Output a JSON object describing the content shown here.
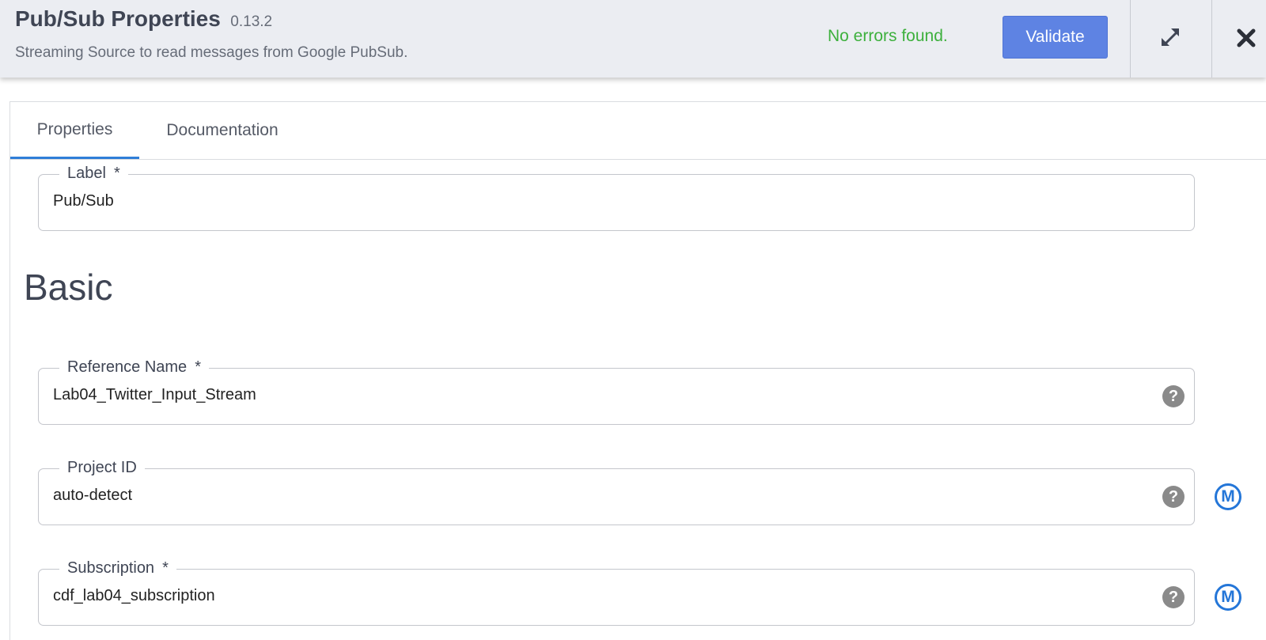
{
  "header": {
    "title": "Pub/Sub Properties",
    "version": "0.13.2",
    "subtitle": "Streaming Source to read messages from Google PubSub.",
    "status_text": "No errors found.",
    "validate_label": "Validate",
    "expand_icon": "expand-arrows-icon",
    "close_icon": "close-icon"
  },
  "tabs": [
    {
      "label": "Properties",
      "active": true
    },
    {
      "label": "Documentation",
      "active": false
    }
  ],
  "label_field": {
    "label": "Label",
    "required_mark": "*",
    "value": "Pub/Sub"
  },
  "section": {
    "title": "Basic"
  },
  "fields": [
    {
      "label": "Reference Name",
      "required_mark": "*",
      "value": "Lab04_Twitter_Input_Stream",
      "help": "?",
      "macro": ""
    },
    {
      "label": "Project ID",
      "required_mark": "",
      "value": "auto-detect",
      "help": "?",
      "macro": "M"
    },
    {
      "label": "Subscription",
      "required_mark": "*",
      "value": "cdf_lab04_subscription",
      "help": "?",
      "macro": "M"
    }
  ],
  "colors": {
    "header_bg": "#ebedf2",
    "status_ok": "#3db03d",
    "validate_bg": "#5e83e3",
    "tab_active": "#2f7ed8",
    "macro": "#2476d8"
  }
}
